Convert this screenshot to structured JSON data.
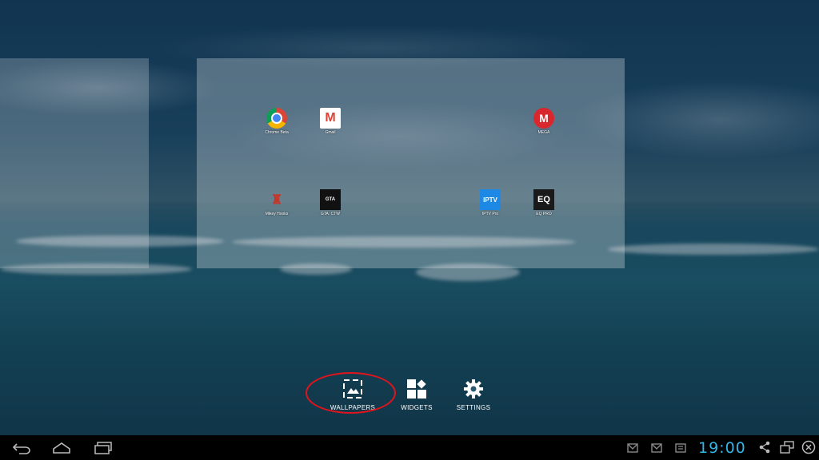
{
  "workspace": {
    "apps": [
      {
        "id": "chrome",
        "label": "Chrome Beta",
        "glyph": "BETA"
      },
      {
        "id": "gmail",
        "label": "Gmail",
        "glyph": "M"
      },
      {
        "id": "mega",
        "label": "MEGA",
        "glyph": "M"
      },
      {
        "id": "mikey",
        "label": "Mikey Hooks",
        "glyph": "♜"
      },
      {
        "id": "gta",
        "label": "GTA: CTW",
        "glyph": "GTA"
      },
      {
        "id": "iptv",
        "label": "IPTV Pro",
        "glyph": "IPTV"
      },
      {
        "id": "eq",
        "label": "EQ PRO",
        "glyph": "EQ"
      }
    ]
  },
  "options": {
    "wallpapers": "WALLPAPERS",
    "widgets": "WIDGETS",
    "settings": "SETTINGS",
    "highlight_color": "#e0141c"
  },
  "navbar": {
    "clock": "19:00",
    "clock_color": "#33b5e5",
    "buttons": [
      "back-icon",
      "home-icon",
      "recents-icon"
    ],
    "status_icons": [
      "gmail-notification-icon",
      "gmail-notification-icon",
      "download-notification-icon",
      "share-icon",
      "screen-icon",
      "close-icon"
    ]
  }
}
